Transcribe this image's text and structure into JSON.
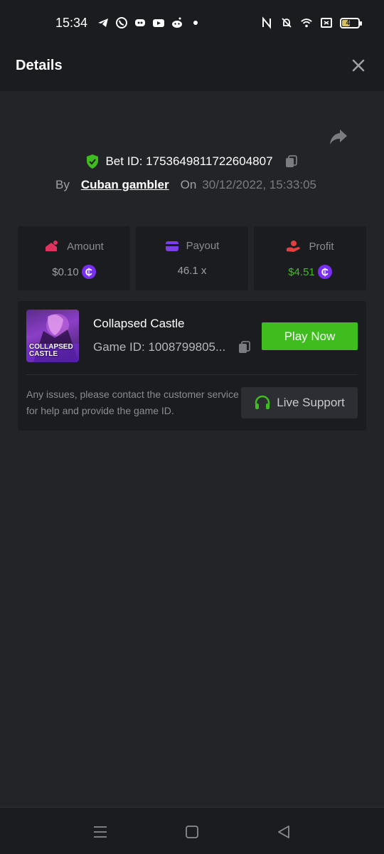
{
  "status_bar": {
    "time": "15:34",
    "battery": "46",
    "icons_left": [
      "telegram-icon",
      "whatsapp-icon",
      "discord-icon",
      "youtube-icon",
      "reddit-icon",
      "dot-icon"
    ],
    "icons_right": [
      "nfc-icon",
      "bell-off-icon",
      "wifi-icon",
      "screen-icon",
      "battery-icon"
    ]
  },
  "header": {
    "title": "Details"
  },
  "bet": {
    "id_text": "Bet ID: 1753649811722604807",
    "by_label": "By",
    "user": "Cuban gambler",
    "on_label": "On",
    "datetime": "30/12/2022, 15:33:05"
  },
  "stats": {
    "amount_label": "Amount",
    "amount_value": "$0.10",
    "payout_label": "Payout",
    "payout_value": "46.1 x",
    "profit_label": "Profit",
    "profit_value": "$4.51",
    "coin_symbol": "₵"
  },
  "game": {
    "thumb_line1": "COLLAPSED",
    "thumb_line2": "CASTLE",
    "name": "Collapsed Castle",
    "id_text": "Game ID: 1008799805...",
    "play_label": "Play Now"
  },
  "support": {
    "message": "Any issues, please contact the customer service for help and provide the game ID.",
    "button_label": "Live Support"
  },
  "colors": {
    "background": "#232428",
    "panel": "#1b1c1f",
    "accent_green": "#3fbd1f",
    "coin_purple": "#7a2ef2",
    "amount_pink": "#e0325f",
    "payout_purple": "#7b3fe4",
    "profit_red": "#e04040"
  }
}
